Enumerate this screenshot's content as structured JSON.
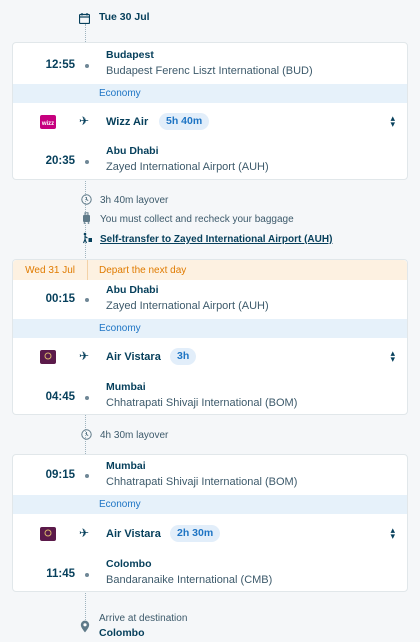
{
  "header": {
    "date": "Tue 30 Jul"
  },
  "segments": [
    {
      "dep_time": "12:55",
      "dep_city": "Budapest",
      "dep_airport": "Budapest Ferenc Liszt International (BUD)",
      "cabin": "Economy",
      "carrier": "Wizz Air",
      "duration": "5h 40m",
      "arr_time": "20:35",
      "arr_city": "Abu Dhabi",
      "arr_airport": "Zayed International Airport (AUH)",
      "logo_color": "#c6007e"
    },
    {
      "dep_time": "00:15",
      "dep_city": "Abu Dhabi",
      "dep_airport": "Zayed International Airport (AUH)",
      "cabin": "Economy",
      "carrier": "Air Vistara",
      "duration": "3h",
      "arr_time": "04:45",
      "arr_city": "Mumbai",
      "arr_airport": "Chhatrapati Shivaji International (BOM)",
      "logo_color": "#5b1a4a"
    },
    {
      "dep_time": "09:15",
      "dep_city": "Mumbai",
      "dep_airport": "Chhatrapati Shivaji International (BOM)",
      "cabin": "Economy",
      "carrier": "Air Vistara",
      "duration": "2h 30m",
      "arr_time": "11:45",
      "arr_city": "Colombo",
      "arr_airport": "Bandaranaike International (CMB)",
      "logo_color": "#5b1a4a"
    }
  ],
  "layover1": {
    "duration": "3h 40m layover",
    "baggage": "You must collect and recheck your baggage",
    "transfer": "Self-transfer to Zayed International Airport (AUH)"
  },
  "next_day": {
    "date": "Wed 31 Jul",
    "text": "Depart the next day"
  },
  "layover2": {
    "duration": "4h 30m layover"
  },
  "arrival": {
    "label": "Arrive at destination",
    "city": "Colombo"
  },
  "colors": {
    "accent": "#1d74c4",
    "warning": "#e07b00",
    "text": "#07405c"
  }
}
